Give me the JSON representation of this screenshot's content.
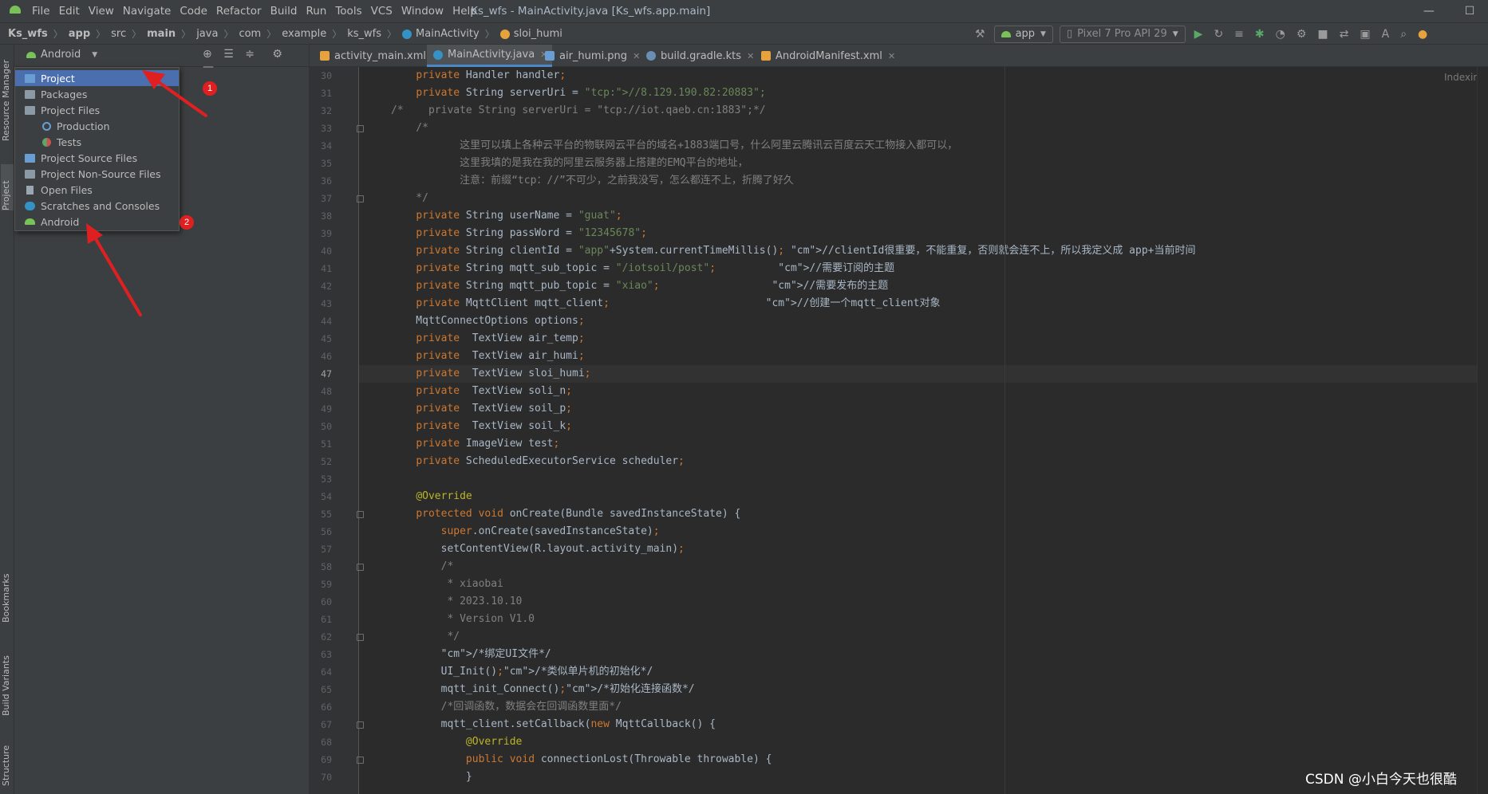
{
  "app": {
    "menu": [
      "File",
      "Edit",
      "View",
      "Navigate",
      "Code",
      "Refactor",
      "Build",
      "Run",
      "Tools",
      "VCS",
      "Window",
      "Help"
    ],
    "window_title": "Ks_wfs - MainActivity.java [Ks_wfs.app.main]",
    "win_min": "—",
    "win_max": "☐"
  },
  "breadcrumb": [
    "Ks_wfs",
    "app",
    "src",
    "main",
    "java",
    "com",
    "example",
    "ks_wfs",
    "MainActivity",
    "sloi_humi"
  ],
  "toolbar": {
    "run_config": "app",
    "device": "Pixel 7 Pro API 29"
  },
  "side_tabs": {
    "resource_manager": "Resource Manager",
    "project": "Project",
    "bookmarks": "Bookmarks",
    "build_variants": "Build Variants",
    "structure": "Structure"
  },
  "project_panel": {
    "view_selector": "Android"
  },
  "view_menu": {
    "items": [
      "Project",
      "Packages",
      "Project Files",
      "Production",
      "Tests",
      "Project Source Files",
      "Project Non-Source Files",
      "Open Files",
      "Scratches and Consoles",
      "Android"
    ],
    "selected": "Project"
  },
  "badges": [
    "1",
    "2"
  ],
  "tabs": [
    "activity_main.xml",
    "MainActivity.java",
    "air_humi.png",
    "build.gradle.kts",
    "AndroidManifest.xml"
  ],
  "active_tab": "MainActivity.java",
  "editor": {
    "status": "Indexing...",
    "current_line": 47,
    "line_numbers": [
      "30",
      "31",
      "32",
      "33",
      "34",
      "35",
      "36",
      "37",
      "38",
      "39",
      "40",
      "41",
      "42",
      "43",
      "44",
      "45",
      "46",
      "47",
      "48",
      "49",
      "50",
      "51",
      "52",
      "53",
      "54",
      "55",
      "56",
      "57",
      "58",
      "59",
      "60",
      "61",
      "62",
      "63",
      "64",
      "65",
      "66",
      "67",
      "68",
      "69",
      "70"
    ],
    "lines": [
      "    private Handler handler;",
      "    private String serverUri = \"tcp://8.129.190.82:20883\";",
      "/*    private String serverUri = \"tcp://iot.qaeb.cn:1883\";*/",
      "    /*",
      "           这里可以填上各种云平台的物联网云平台的域名+1883端口号，什么阿里云腾讯云百度云天工物接入都可以，",
      "           这里我填的是我在我的阿里云服务器上搭建的EMQ平台的地址，",
      "           注意：前缀“tcp：//”不可少，之前我没写，怎么都连不上，折腾了好久",
      "    */",
      "    private String userName = \"guat\";",
      "    private String passWord = \"12345678\";",
      "    private String clientId = \"app\"+System.currentTimeMillis(); //clientId很重要，不能重复，否则就会连不上，所以我定义成 app+当前时间",
      "    private String mqtt_sub_topic = \"/iotsoil/post\";          //需要订阅的主题",
      "    private String mqtt_pub_topic = \"xiao\";                  //需要发布的主题",
      "    private MqttClient mqtt_client;                         //创建一个mqtt_client对象",
      "    MqttConnectOptions options;",
      "    private  TextView air_temp;",
      "    private  TextView air_humi;",
      "    private  TextView sloi_humi;",
      "    private  TextView soli_n;",
      "    private  TextView soil_p;",
      "    private  TextView soil_k;",
      "    private ImageView test;",
      "    private ScheduledExecutorService scheduler;",
      "",
      "    @Override",
      "    protected void onCreate(Bundle savedInstanceState) {",
      "        super.onCreate(savedInstanceState);",
      "        setContentView(R.layout.activity_main);",
      "        /*",
      "         * xiaobai",
      "         * 2023.10.10",
      "         * Version V1.0",
      "         */",
      "        /*绑定UI文件*/",
      "        UI_Init();/*类似单片机的初始化*/",
      "        mqtt_init_Connect();/*初始化连接函数*/",
      "        /*回调函数，数据会在回调函数里面*/",
      "        mqtt_client.setCallback(new MqttCallback() {",
      "            @Override",
      "            public void connectionLost(Throwable throwable) {",
      "            }"
    ]
  },
  "watermark": "CSDN @小白今天也很酷",
  "colors": {
    "keyword": "#cc7832",
    "string": "#6a8759",
    "comment": "#808080",
    "annotation": "#bbb529",
    "selection": "#4b6eaf",
    "badge": "#e02020"
  }
}
